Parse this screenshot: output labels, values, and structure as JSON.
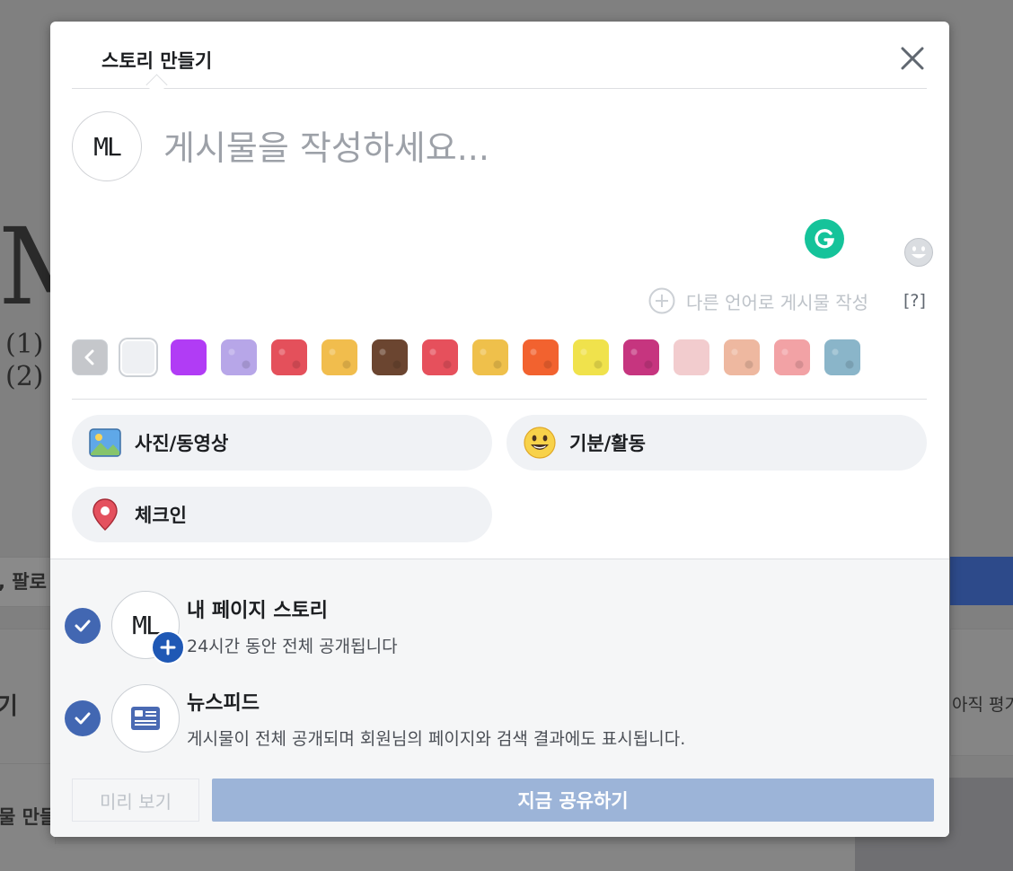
{
  "background": {
    "big_letter": "M",
    "list_items": [
      "(1)",
      "(2)"
    ],
    "follow_fragment": ", 팔로",
    "gi_fragment": "기",
    "create_fragment": "물 만들",
    "not_yet_fragment": "아직 평가"
  },
  "dialog": {
    "tab_title": "스토리 만들기",
    "avatar_initials": "ML",
    "post_placeholder": "게시물을 작성하세요...",
    "translate_label": "다른 언어로 게시물 작성",
    "help_label": "[?]",
    "swatches": [
      {
        "name": "plain",
        "color": "#eef0f3",
        "selected": true
      },
      {
        "name": "purple",
        "color": "#b13cf5"
      },
      {
        "name": "lavender-pattern",
        "color": "#b7a6e8"
      },
      {
        "name": "watermelon",
        "color": "#e4505b"
      },
      {
        "name": "yellow-pattern",
        "color": "#f1bd4d"
      },
      {
        "name": "chocolate",
        "color": "#6b4530"
      },
      {
        "name": "red-pattern",
        "color": "#e6505c"
      },
      {
        "name": "gold-pattern",
        "color": "#efc04b"
      },
      {
        "name": "orange-fire",
        "color": "#f2622f"
      },
      {
        "name": "yellow-green-pattern",
        "color": "#f0e24c"
      },
      {
        "name": "magenta-leaves",
        "color": "#c6357f"
      },
      {
        "name": "pale-pink",
        "color": "#f2ccce"
      },
      {
        "name": "peach-leaves",
        "color": "#eeb8a0"
      },
      {
        "name": "pink-pattern",
        "color": "#f2a2a5"
      },
      {
        "name": "blue-mountains",
        "color": "#8ab5c9"
      }
    ],
    "actions": {
      "photo_video": "사진/동영상",
      "feeling_activity": "기분/활동",
      "check_in": "체크인"
    },
    "options": {
      "story": {
        "avatar_initials": "ML",
        "title": "내 페이지 스토리",
        "desc": "24시간 동안 전체 공개됩니다"
      },
      "news_feed": {
        "title": "뉴스피드",
        "desc": "게시물이 전체 공개되며 회원님의 페이지와 검색 결과에도 표시됩니다."
      }
    },
    "buttons": {
      "preview": "미리 보기",
      "share_now": "지금 공유하기"
    }
  },
  "colors": {
    "accent": "#4267b2",
    "share_disabled": "#9cb4d8",
    "grammarly": "#15c39a",
    "overlay": "#808080"
  }
}
